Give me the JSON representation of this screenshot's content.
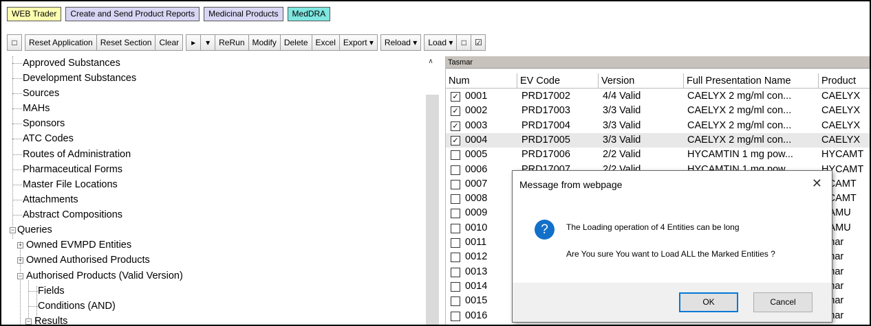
{
  "tabs": [
    "WEB Trader",
    "Create and Send Product Reports",
    "Medicinal Products",
    "MedDRA"
  ],
  "toolbar": {
    "square_icon": "□",
    "reset_application": "Reset Application",
    "reset_section": "Reset Section",
    "clear": "Clear",
    "play_icon": "▸",
    "dropdown_icon": "▾",
    "rerun": "ReRun",
    "modify": "Modify",
    "delete": "Delete",
    "excel": "Excel",
    "export": "Export ▾",
    "reload": "Reload ▾",
    "load": "Load ▾",
    "box_empty": "□",
    "box_checked": "☑"
  },
  "tree": {
    "scroll_up_icon": "∧",
    "items": [
      "Approved Substances",
      "Development Substances",
      "Sources",
      "MAHs",
      "Sponsors",
      "ATC Codes",
      "Routes of Administration",
      "Pharmaceutical Forms",
      "Master File Locations",
      "Attachments",
      "Abstract Compositions",
      "Queries",
      "Owned EVMPD Entities",
      "Owned Authorised Products",
      "Authorised Products (Valid Version)",
      "Fields",
      "Conditions (AND)",
      "Results"
    ]
  },
  "grid": {
    "caption": "Tasmar",
    "columns": [
      "Num",
      "EV Code",
      "Version",
      "Full Presentation Name",
      "Product"
    ],
    "rows": [
      {
        "checked": true,
        "num": "0001",
        "ev": "PRD17002",
        "version": "4/4 Valid",
        "name": "CAELYX 2 mg/ml con...",
        "product": "CAELYX"
      },
      {
        "checked": true,
        "num": "0002",
        "ev": "PRD17003",
        "version": "3/3 Valid",
        "name": "CAELYX 2 mg/ml con...",
        "product": "CAELYX"
      },
      {
        "checked": true,
        "num": "0003",
        "ev": "PRD17004",
        "version": "3/3 Valid",
        "name": "CAELYX 2 mg/ml con...",
        "product": "CAELYX"
      },
      {
        "checked": true,
        "num": "0004",
        "ev": "PRD17005",
        "version": "3/3 Valid",
        "name": "CAELYX 2 mg/ml con...",
        "product": "CAELYX"
      },
      {
        "checked": false,
        "num": "0005",
        "ev": "PRD17006",
        "version": "2/2 Valid",
        "name": "HYCAMTIN 1 mg pow...",
        "product": "HYCAMT"
      },
      {
        "checked": false,
        "num": "0006",
        "ev": "PRD17007",
        "version": "2/2 Valid",
        "name": "HYCAMTIN 1 mg pow...",
        "product": "HYCAMT"
      },
      {
        "checked": false,
        "num": "0007",
        "ev": "",
        "version": "",
        "name": "",
        "product": "YCAMT"
      },
      {
        "checked": false,
        "num": "0008",
        "ev": "",
        "version": "",
        "name": "",
        "product": "YCAMT"
      },
      {
        "checked": false,
        "num": "0009",
        "ev": "",
        "version": "",
        "name": "",
        "product": "RAMU"
      },
      {
        "checked": false,
        "num": "0010",
        "ev": "",
        "version": "",
        "name": "",
        "product": "RAMU"
      },
      {
        "checked": false,
        "num": "0011",
        "ev": "",
        "version": "",
        "name": "",
        "product": "smar"
      },
      {
        "checked": false,
        "num": "0012",
        "ev": "",
        "version": "",
        "name": "",
        "product": "smar"
      },
      {
        "checked": false,
        "num": "0013",
        "ev": "",
        "version": "",
        "name": "",
        "product": "smar"
      },
      {
        "checked": false,
        "num": "0014",
        "ev": "",
        "version": "",
        "name": "",
        "product": "smar"
      },
      {
        "checked": false,
        "num": "0015",
        "ev": "",
        "version": "",
        "name": "",
        "product": "smar"
      },
      {
        "checked": false,
        "num": "0016",
        "ev": "",
        "version": "",
        "name": "",
        "product": "smar"
      }
    ],
    "selected_row": 3
  },
  "dialog": {
    "title": "Message from webpage",
    "close_icon": "✕",
    "question_icon": "?",
    "line1": "The Loading operation of 4 Entities can be long",
    "line2": "Are You sure You want to Load ALL the Marked Entities ?",
    "ok": "OK",
    "cancel": "Cancel"
  }
}
